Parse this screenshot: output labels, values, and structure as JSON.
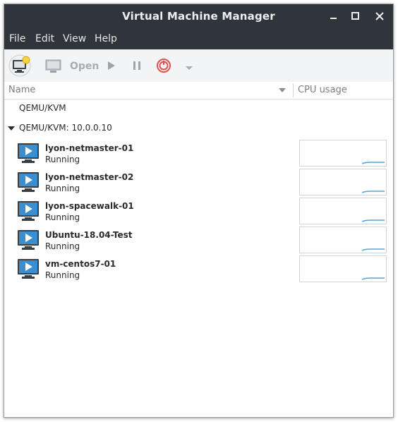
{
  "window": {
    "title": "Virtual Machine Manager",
    "controls": [
      "minimize",
      "maximize",
      "close"
    ]
  },
  "menu": {
    "items": [
      "File",
      "Edit",
      "View",
      "Help"
    ]
  },
  "toolbar": {
    "open_label": "Open",
    "icons": [
      "new-vm-icon",
      "console-icon",
      "play-icon",
      "pause-icon",
      "power-icon",
      "dropdown-arrow-icon"
    ]
  },
  "columns": {
    "name": "Name",
    "cpu": "CPU usage"
  },
  "connections": [
    {
      "label": "QEMU/KVM",
      "expanded": false
    },
    {
      "label": "QEMU/KVM: 10.0.0.10",
      "expanded": true
    }
  ],
  "vms": [
    {
      "name": "lyon-netmaster-01",
      "status": "Running"
    },
    {
      "name": "lyon-netmaster-02",
      "status": "Running"
    },
    {
      "name": "lyon-spacewalk-01",
      "status": "Running"
    },
    {
      "name": "Ubuntu-18.04-Test",
      "status": "Running"
    },
    {
      "name": "vm-centos7-01",
      "status": "Running"
    }
  ],
  "colors": {
    "titlebar": "#2f353a",
    "accent": "#3b8fd0",
    "cpu_line": "#5aa1d6",
    "power_red": "#e0524f"
  }
}
